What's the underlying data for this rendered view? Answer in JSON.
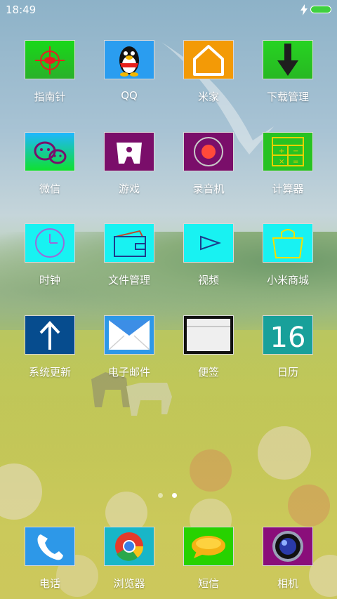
{
  "status_bar": {
    "time": "18:49",
    "battery_color": "#3fd03f"
  },
  "home": {
    "rows": [
      [
        {
          "label": "指南针",
          "icon": "compass-icon",
          "bg": "#22c61e"
        },
        {
          "label": "QQ",
          "icon": "qq-penguin-icon",
          "bg": "#2a9df0"
        },
        {
          "label": "米家",
          "icon": "home-icon",
          "bg": "#f39a06"
        },
        {
          "label": "下载管理",
          "icon": "download-arrow-icon",
          "bg": "#27c222"
        }
      ],
      [
        {
          "label": "微信",
          "icon": "wechat-icon",
          "bg": "#22c61e"
        },
        {
          "label": "游戏",
          "icon": "gamepad-icon",
          "bg": "#7a0e6a"
        },
        {
          "label": "录音机",
          "icon": "record-icon",
          "bg": "#7a0e6a"
        },
        {
          "label": "计算器",
          "icon": "calculator-icon",
          "bg": "#27c222"
        }
      ],
      [
        {
          "label": "时钟",
          "icon": "clock-icon",
          "bg": "#18f2f2"
        },
        {
          "label": "文件管理",
          "icon": "wallet-icon",
          "bg": "#18f2f2"
        },
        {
          "label": "视频",
          "icon": "play-icon",
          "bg": "#18f2f2"
        },
        {
          "label": "小米商城",
          "icon": "shopping-bag-icon",
          "bg": "#18f2f2"
        }
      ],
      [
        {
          "label": "系统更新",
          "icon": "update-arrow-icon",
          "bg": "#064c8e"
        },
        {
          "label": "电子邮件",
          "icon": "envelope-icon",
          "bg": "#2d98e8"
        },
        {
          "label": "便签",
          "icon": "note-icon",
          "bg": "#111111"
        },
        {
          "label": "日历",
          "icon": "calendar-icon",
          "bg": "#18a09a",
          "text": "16"
        }
      ]
    ]
  },
  "page_indicator": {
    "pages": 2,
    "active": 2
  },
  "dock": [
    {
      "label": "电话",
      "icon": "phone-icon",
      "bg": "#2d98e8"
    },
    {
      "label": "浏览器",
      "icon": "browser-icon",
      "bg": "#18b6c8"
    },
    {
      "label": "短信",
      "icon": "message-icon",
      "bg": "#27d200"
    },
    {
      "label": "相机",
      "icon": "camera-icon",
      "bg": "#8a0e7a"
    }
  ]
}
